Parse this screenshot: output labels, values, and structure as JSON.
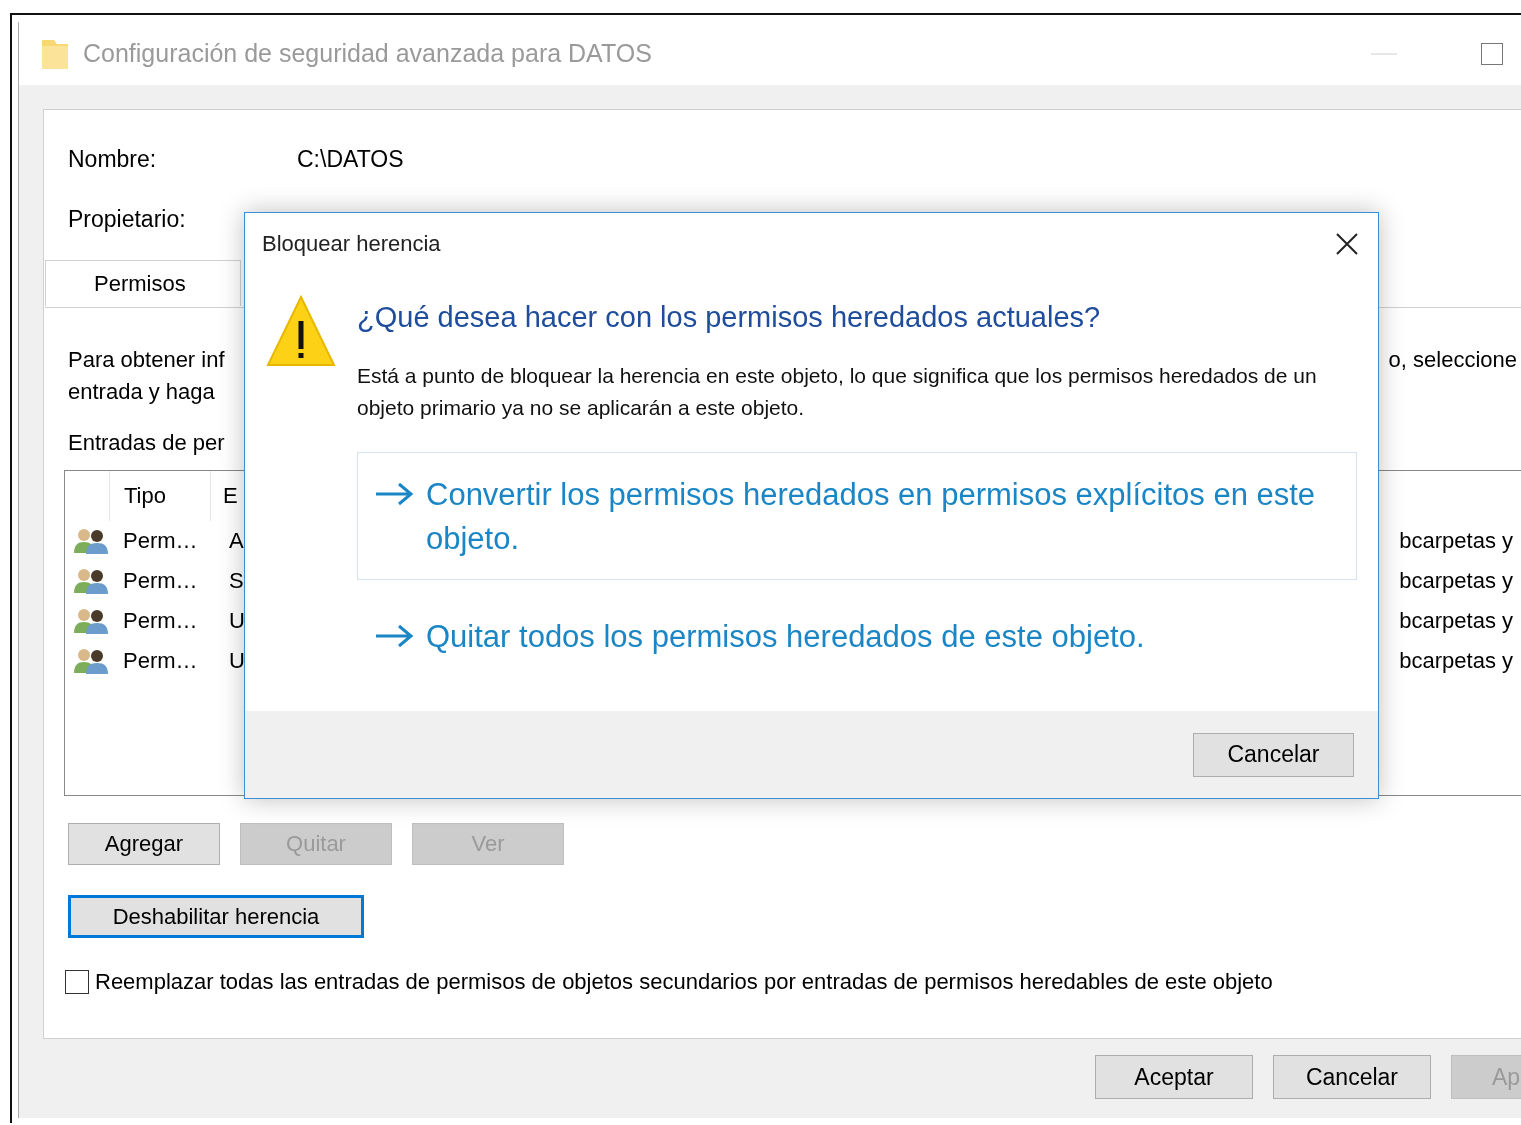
{
  "window": {
    "title": "Configuración de seguridad avanzada para DATOS"
  },
  "fields": [
    {
      "label": "Nombre:",
      "value": "C:\\DATOS"
    },
    {
      "label": "Propietario:"
    }
  ],
  "tabs": [
    {
      "label": "Permisos",
      "selected": true
    }
  ],
  "description_left": [
    "Para obtener inf",
    "entrada y haga"
  ],
  "description_right": "o, seleccione",
  "entries_label": "Entradas de per",
  "entries_table": {
    "columns": [
      "Tipo",
      "E"
    ],
    "rows": [
      {
        "cells": [
          "Perm…",
          "A",
          "bcarpetas y"
        ]
      },
      {
        "cells": [
          "Perm…",
          "S",
          "bcarpetas y"
        ]
      },
      {
        "cells": [
          "Perm…",
          "U",
          "bcarpetas y"
        ]
      },
      {
        "cells": [
          "Perm…",
          "U",
          "bcarpetas y"
        ]
      }
    ]
  },
  "buttons": [
    {
      "label": "Agregar",
      "disabled": false
    },
    {
      "label": "Quitar",
      "disabled": true
    },
    {
      "label": "Ver",
      "disabled": true
    }
  ],
  "inheritance_button": {
    "label": "Deshabilitar herencia",
    "focused": true
  },
  "replace_checkbox": {
    "label": "Reemplazar todas las entradas de permisos de objetos secundarios por entradas de permisos heredables de este objeto",
    "checked": false
  },
  "footer_buttons": [
    {
      "label": "Aceptar",
      "disabled": false
    },
    {
      "label": "Cancelar",
      "disabled": false
    },
    {
      "label": "Ap",
      "disabled": true
    }
  ],
  "dialog": {
    "title": "Bloquear herencia",
    "heading": "¿Qué desea hacer con los permisos heredados actuales?",
    "message": "Está a punto de bloquear la herencia en este objeto, lo que significa que los permisos heredados de un objeto primario ya no se aplicarán a este objeto.",
    "options": [
      {
        "label": "Convertir los permisos heredados en permisos explícitos en este objeto.",
        "selected": true
      },
      {
        "label": "Quitar todos los permisos heredados de este objeto.",
        "selected": false
      }
    ],
    "cancel": "Cancelar"
  }
}
